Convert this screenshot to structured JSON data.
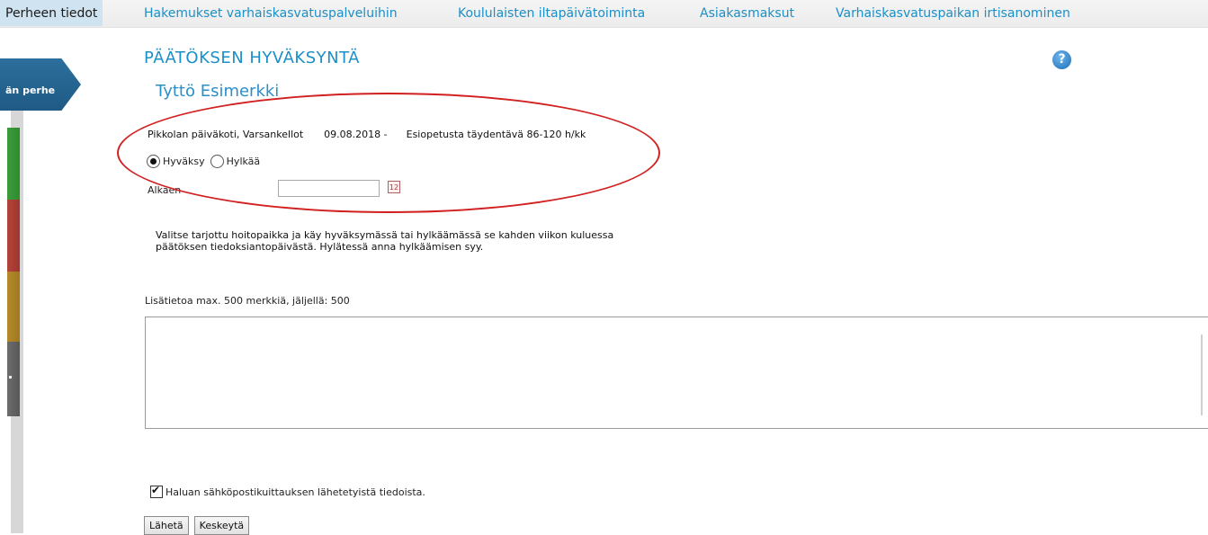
{
  "nav": {
    "tabs": [
      {
        "label": "Perheen tiedot",
        "active": true
      },
      {
        "label": "Hakemukset varhaiskasvatuspalveluihin",
        "active": false
      },
      {
        "label": "Koululaisten iltapäivätoiminta",
        "active": false
      },
      {
        "label": "Asiakasmaksut",
        "active": false
      },
      {
        "label": "Varhaiskasvatuspaikan irtisanominen",
        "active": false
      }
    ]
  },
  "sidebar": {
    "active_label": "än perhe",
    "colors": [
      "#1f5a85",
      "#2f8a2f",
      "#9e352c",
      "#9f7820",
      "#575757"
    ]
  },
  "page": {
    "title": "PÄÄTÖKSEN HYVÄKSYNTÄ",
    "help_icon": "help-question-icon",
    "child_name": "Tyttö Esimerkki"
  },
  "placement": {
    "unit": "Pikkolan päiväkoti, Varsankellot",
    "start": "09.08.2018 -",
    "service": "Esiopetusta täydentävä 86-120 h/kk"
  },
  "decision": {
    "accept_label": "Hyväksy",
    "reject_label": "Hylkää",
    "selected": "accept"
  },
  "start_date": {
    "label": "Alkaen",
    "value": "",
    "calendar_icon_text": "12"
  },
  "instructions": "Valitse tarjottu hoitopaikka ja käy hyväksymässä tai hylkäämässä se kahden viikon kuluessa päätöksen tiedoksiantopäivästä. Hylätessä anna hylkäämisen syy.",
  "extra_info": {
    "label": "Lisätietoa max. 500 merkkiä, jäljellä: 500",
    "value": ""
  },
  "email_receipt": {
    "label": "Haluan sähköpostikuittauksen lähetetyistä tiedoista.",
    "checked": true
  },
  "buttons": {
    "send": "Lähetä",
    "cancel": "Keskeytä"
  },
  "annotation_color": "#d21f1f"
}
